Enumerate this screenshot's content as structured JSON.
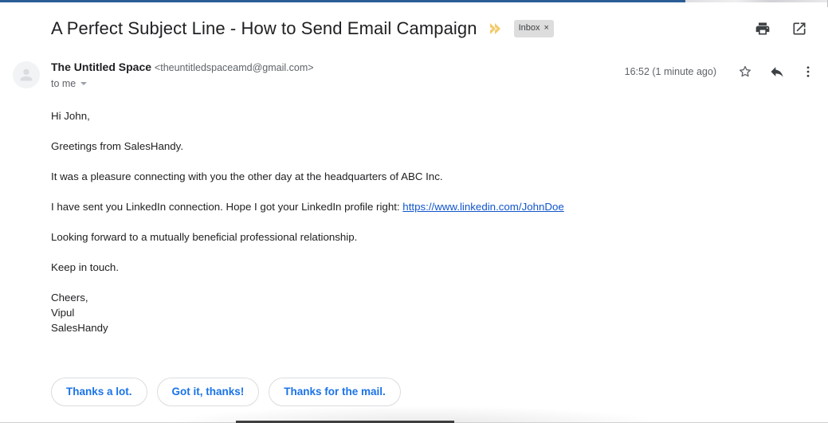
{
  "window": {
    "accent_color": "#2a5d96"
  },
  "header": {
    "subject": "A Perfect Subject Line - How to Send Email Campaign",
    "importance_marker_icon": "yellow-chevron-icon",
    "label": {
      "name": "Inbox",
      "remove": "×"
    },
    "actions": [
      {
        "name": "print-icon",
        "label": "Print all"
      },
      {
        "name": "open-in-new-window-icon",
        "label": "In new window"
      }
    ]
  },
  "sender": {
    "avatar_icon": "person-avatar-icon",
    "name": "The Untitled Space",
    "email": "<theuntitledspaceamd@gmail.com>",
    "recipient": "to me",
    "recipient_caret_icon": "chevron-down-icon",
    "timestamp": "16:52 (1 minute ago)",
    "actions": [
      {
        "name": "star-icon",
        "label": "Star"
      },
      {
        "name": "reply-arrow-icon",
        "label": "Reply"
      },
      {
        "name": "more-options-icon",
        "label": "More"
      }
    ]
  },
  "body": {
    "paragraphs": [
      "Hi John,",
      "Greetings from SalesHandy.",
      "It was a pleasure connecting with you the other day at the headquarters of ABC Inc."
    ],
    "linkedin_line": {
      "before": "I have sent you LinkedIn connection. Hope I got your LinkedIn profile right: ",
      "link_text": "https://www.linkedin.com/JohnDoe",
      "link_color": "#1155cc"
    },
    "paragraphs_after": [
      "Looking forward to a mutually beneficial professional relationship.",
      "Keep in touch."
    ],
    "signature": [
      "Cheers,",
      "Vipul",
      "SalesHandy"
    ]
  },
  "smart_replies": {
    "accent_color": "#1a73e8",
    "options": [
      "Thanks a lot.",
      "Got it, thanks!",
      "Thanks for the mail."
    ]
  }
}
